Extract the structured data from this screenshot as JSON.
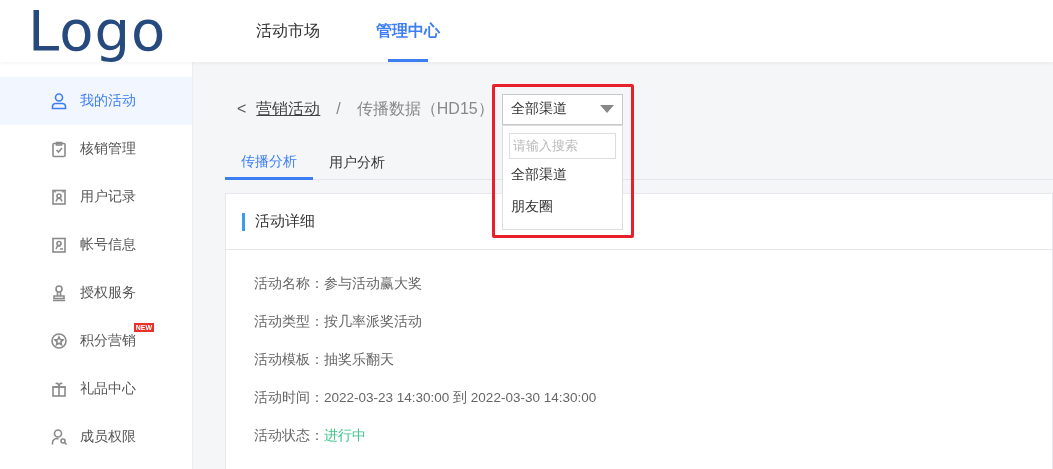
{
  "header": {
    "logo": "Logo",
    "nav": [
      {
        "label": "活动市场",
        "selected": false
      },
      {
        "label": "管理中心",
        "selected": true
      }
    ]
  },
  "sidebar": {
    "items": [
      {
        "label": "我的活动",
        "selected": true
      },
      {
        "label": "核销管理",
        "selected": false
      },
      {
        "label": "用户记录",
        "selected": false
      },
      {
        "label": "帐号信息",
        "selected": false
      },
      {
        "label": "授权服务",
        "selected": false
      },
      {
        "label": "积分营销",
        "selected": false,
        "badge": "NEW"
      },
      {
        "label": "礼品中心",
        "selected": false
      },
      {
        "label": "成员权限",
        "selected": false
      }
    ]
  },
  "breadcrumb": {
    "back": "<",
    "link": "营销活动",
    "separator": "/",
    "current": "传播数据（HD15）"
  },
  "channel_select": {
    "value": "全部渠道",
    "expanded": true,
    "search_placeholder": "请输入搜索",
    "options": [
      {
        "label": "全部渠道"
      },
      {
        "label": "朋友圈"
      }
    ]
  },
  "tabs": [
    {
      "label": "传播分析",
      "selected": true
    },
    {
      "label": "用户分析",
      "selected": false
    }
  ],
  "detail_card": {
    "title": "活动详细",
    "fields": [
      {
        "label": "活动名称：",
        "value": "参与活动赢大奖",
        "kind": "text"
      },
      {
        "label": "活动类型：",
        "value": "按几率派奖活动",
        "kind": "text"
      },
      {
        "label": "活动模板：",
        "value": "抽奖乐翻天",
        "kind": "text"
      },
      {
        "label": "活动时间：",
        "value": "2022-03-23 14:30:00 到 2022-03-30 14:30:00",
        "kind": "text"
      },
      {
        "label": "活动状态：",
        "value": "进行中",
        "kind": "status"
      }
    ]
  }
}
